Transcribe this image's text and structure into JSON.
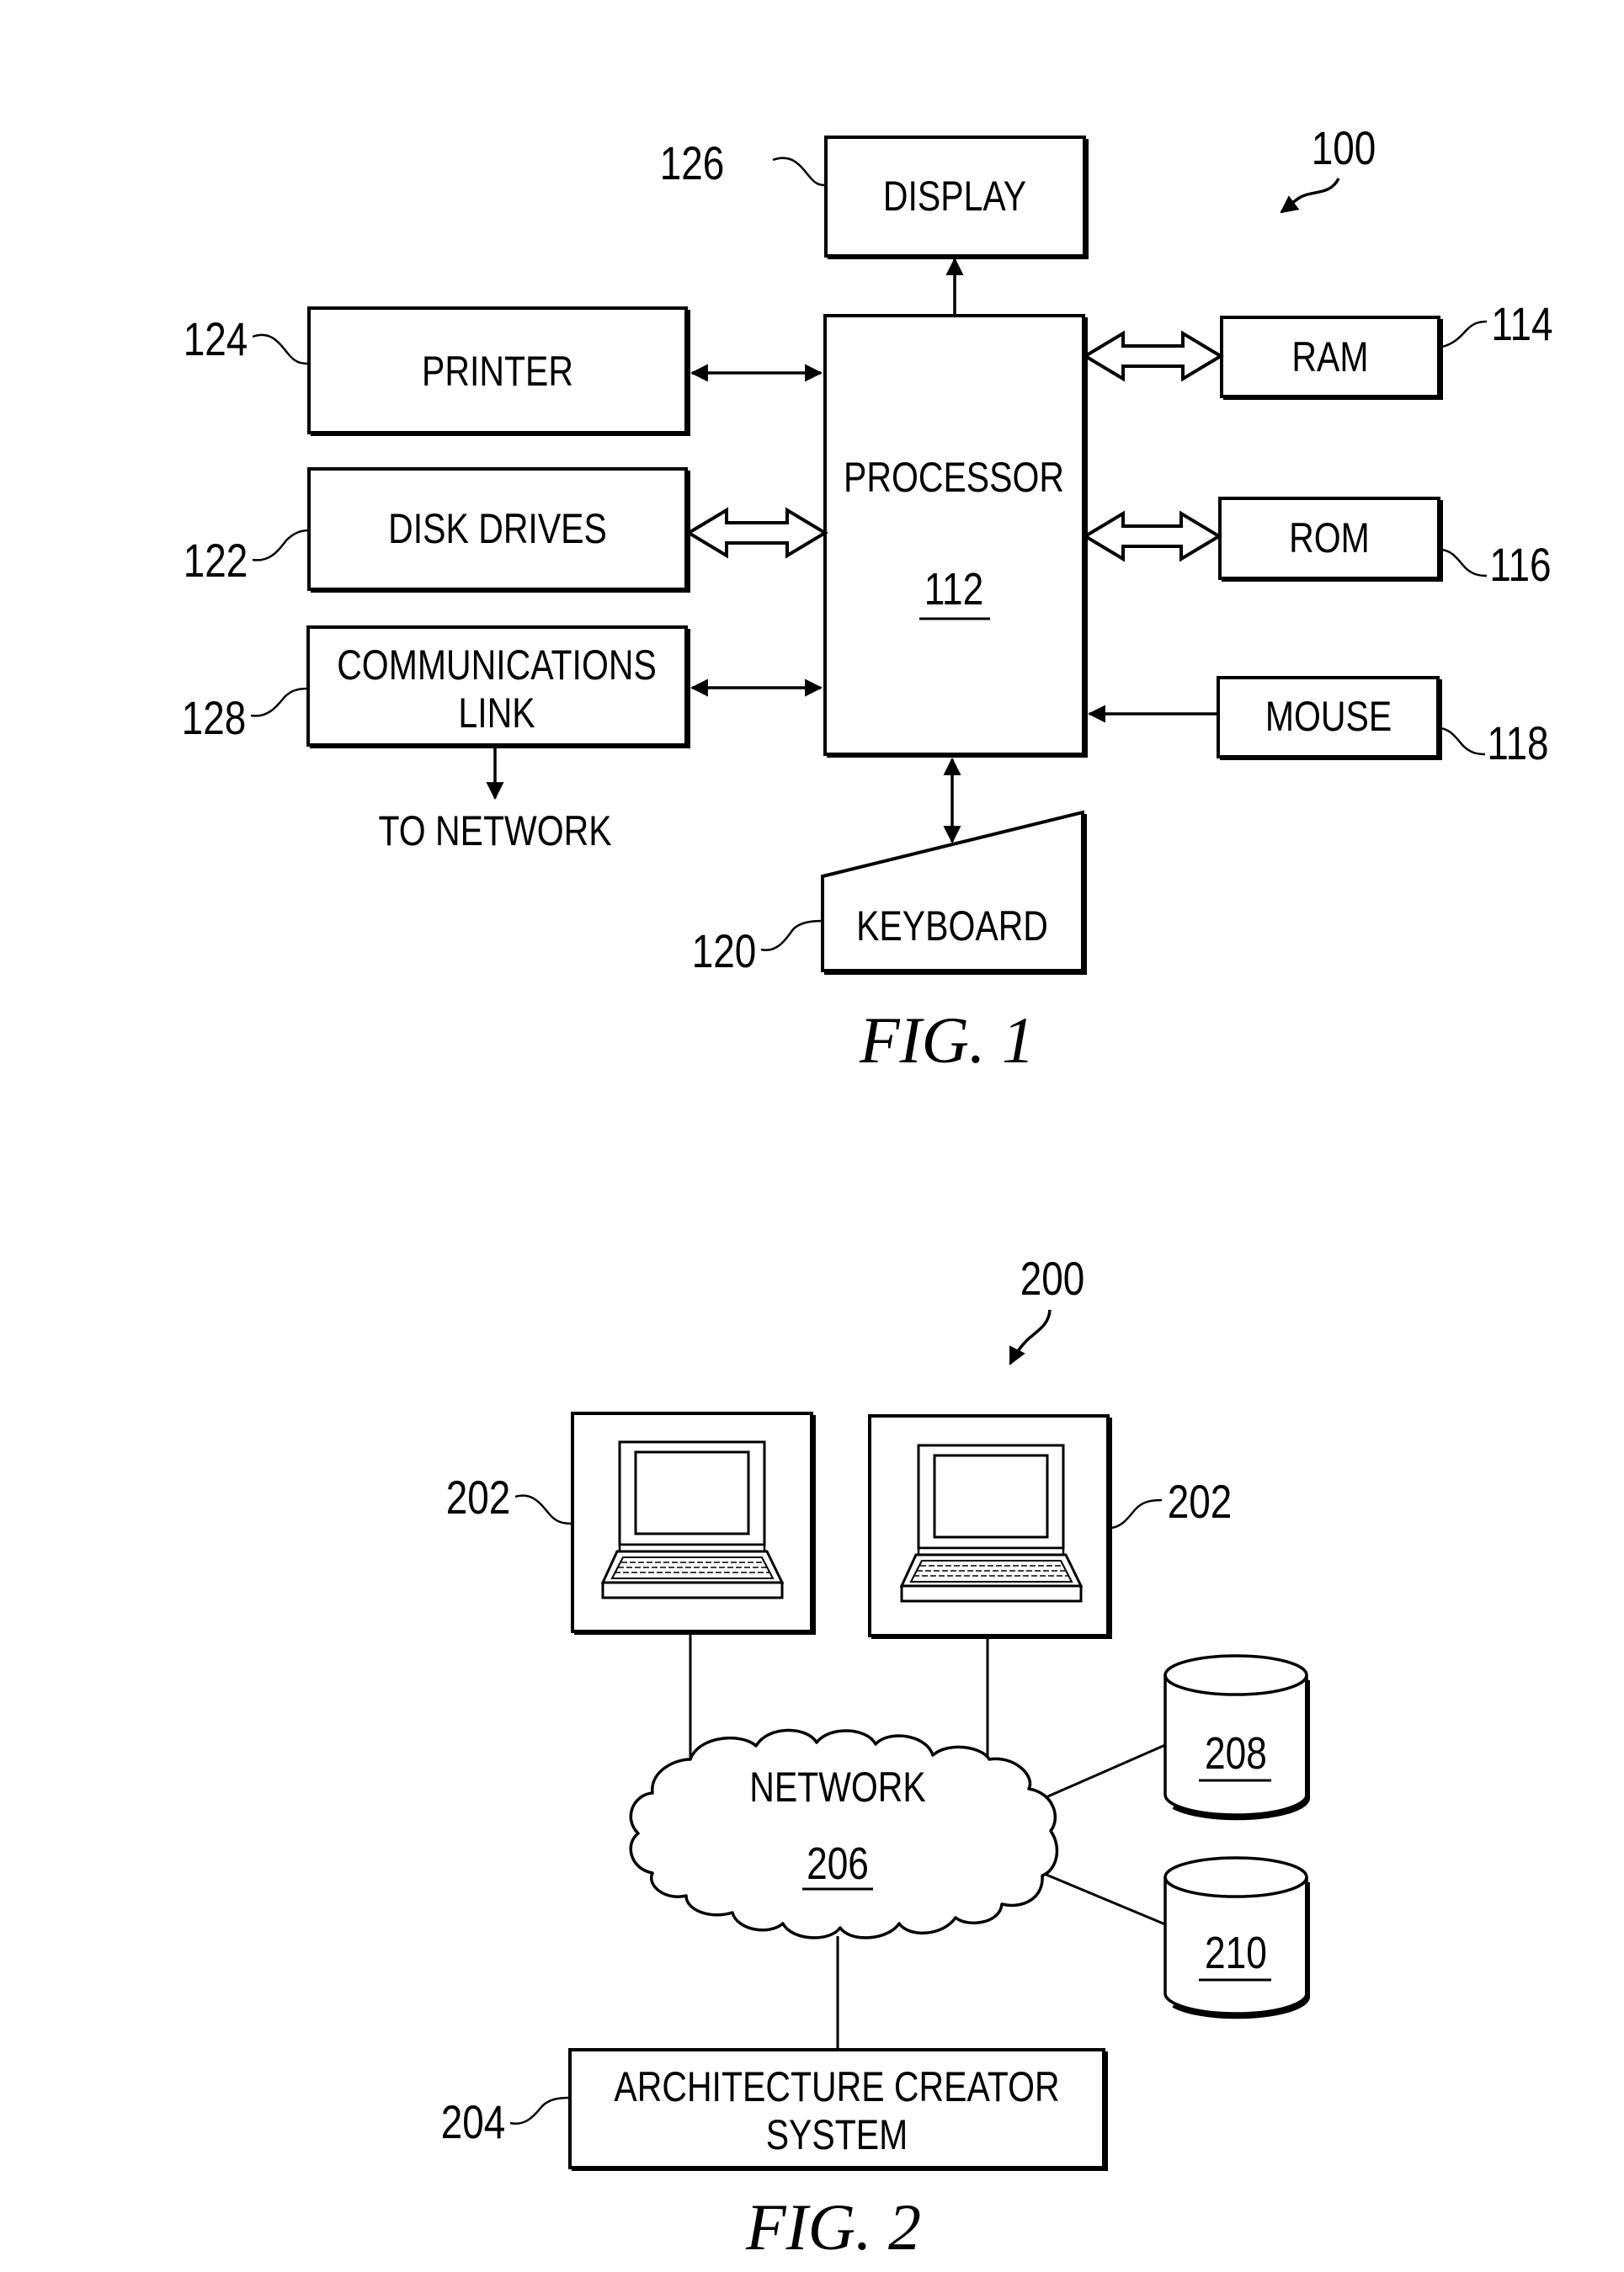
{
  "figure1": {
    "caption": "FIG. 1",
    "system_ref": "100",
    "blocks": {
      "display": {
        "label": "DISPLAY",
        "ref": "126"
      },
      "processor": {
        "label": "PROCESSOR",
        "ref": "112"
      },
      "printer": {
        "label": "PRINTER",
        "ref": "124"
      },
      "disk_drives": {
        "label": "DISK DRIVES",
        "ref": "122"
      },
      "communications_link": {
        "label_line1": "COMMUNICATIONS",
        "label_line2": "LINK",
        "ref": "128"
      },
      "ram": {
        "label": "RAM",
        "ref": "114"
      },
      "rom": {
        "label": "ROM",
        "ref": "116"
      },
      "mouse": {
        "label": "MOUSE",
        "ref": "118"
      },
      "keyboard": {
        "label": "KEYBOARD",
        "ref": "120"
      }
    },
    "to_network_label": "TO NETWORK",
    "connections": [
      {
        "from": "processor",
        "to": "display",
        "type": "single-arrow"
      },
      {
        "from": "printer",
        "to": "processor",
        "type": "double-arrow"
      },
      {
        "from": "disk_drives",
        "to": "processor",
        "type": "bus-arrow"
      },
      {
        "from": "communications_link",
        "to": "processor",
        "type": "double-arrow"
      },
      {
        "from": "communications_link",
        "to": "network",
        "type": "single-arrow"
      },
      {
        "from": "processor",
        "to": "ram",
        "type": "bus-arrow"
      },
      {
        "from": "processor",
        "to": "rom",
        "type": "bus-arrow"
      },
      {
        "from": "mouse",
        "to": "processor",
        "type": "single-arrow"
      },
      {
        "from": "processor",
        "to": "keyboard",
        "type": "double-arrow"
      }
    ]
  },
  "figure2": {
    "caption": "FIG. 2",
    "system_ref": "200",
    "clients": [
      {
        "ref": "202",
        "icon": "laptop-icon"
      },
      {
        "ref": "202",
        "icon": "laptop-icon"
      }
    ],
    "network": {
      "label": "NETWORK",
      "ref": "206"
    },
    "databases": [
      {
        "ref": "208"
      },
      {
        "ref": "210"
      }
    ],
    "architecture_creator": {
      "label_line1": "ARCHITECTURE CREATOR",
      "label_line2": "SYSTEM",
      "ref": "204"
    }
  }
}
